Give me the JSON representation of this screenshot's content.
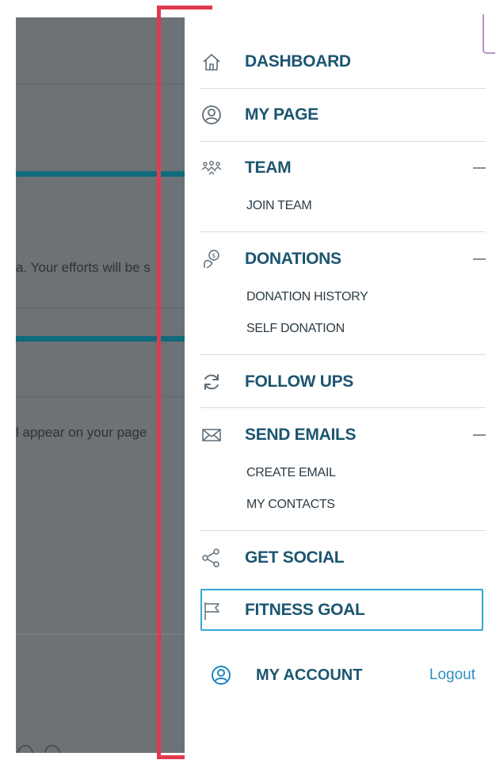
{
  "background": {
    "text_line_1": "a. Your efforts will be s",
    "text_line_2": "l appear on your page"
  },
  "menu": {
    "items": [
      {
        "id": "dashboard",
        "label": "DASHBOARD",
        "icon": "home-icon"
      },
      {
        "id": "my-page",
        "label": "MY PAGE",
        "icon": "user-circle-icon"
      },
      {
        "id": "team",
        "label": "TEAM",
        "icon": "team-icon",
        "expanded": true,
        "subitems": [
          "JOIN TEAM"
        ]
      },
      {
        "id": "donations",
        "label": "DONATIONS",
        "icon": "donation-icon",
        "expanded": true,
        "subitems": [
          "DONATION HISTORY",
          "SELF DONATION"
        ]
      },
      {
        "id": "follow-ups",
        "label": "FOLLOW UPS",
        "icon": "refresh-icon"
      },
      {
        "id": "send-emails",
        "label": "SEND EMAILS",
        "icon": "envelope-icon",
        "expanded": true,
        "subitems": [
          "CREATE EMAIL",
          "MY CONTACTS"
        ]
      },
      {
        "id": "get-social",
        "label": "GET SOCIAL",
        "icon": "share-icon"
      },
      {
        "id": "fitness-goal",
        "label": "FITNESS GOAL",
        "icon": "flag-icon",
        "focused": true
      }
    ],
    "account": {
      "label": "MY ACCOUNT",
      "icon": "user-circle-icon",
      "logout": "Logout"
    }
  },
  "colors": {
    "menu_label": "#1c5570",
    "focus_border": "#35a7d8",
    "logout_link": "#2f8fc4",
    "overlay": "#6c7275",
    "annotation": "#e03a4f"
  }
}
